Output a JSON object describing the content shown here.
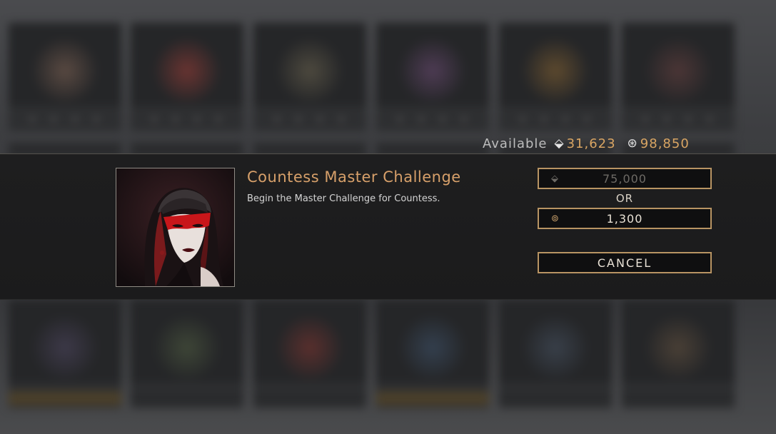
{
  "currency": {
    "available_label": "Available",
    "primary_icon": "gem-coin-icon",
    "primary_amount": "31,623",
    "secondary_icon": "ring-coin-icon",
    "secondary_amount": "98,850",
    "accent_color": "#d9a563"
  },
  "dialog": {
    "title": "Countess Master Challenge",
    "description": "Begin the Master Challenge for Countess.",
    "price_primary": {
      "icon": "gem-coin-icon",
      "amount": "75,000",
      "enabled": false
    },
    "or_label": "OR",
    "price_secondary": {
      "icon": "ring-coin-icon",
      "amount": "1,300",
      "enabled": true
    },
    "cancel_label": "CANCEL",
    "title_color": "#d7a06a",
    "button_border_color": "#b89463"
  },
  "background": {
    "portrait_tints": [
      "#5a4a42",
      "#6a3431",
      "#4e4a3f",
      "#4f3c55",
      "#5e4a2e",
      "#4c3636",
      "#3d3949",
      "#3e4637",
      "#5a2f2d",
      "#34404f",
      "#39404a",
      "#4a4036"
    ]
  }
}
